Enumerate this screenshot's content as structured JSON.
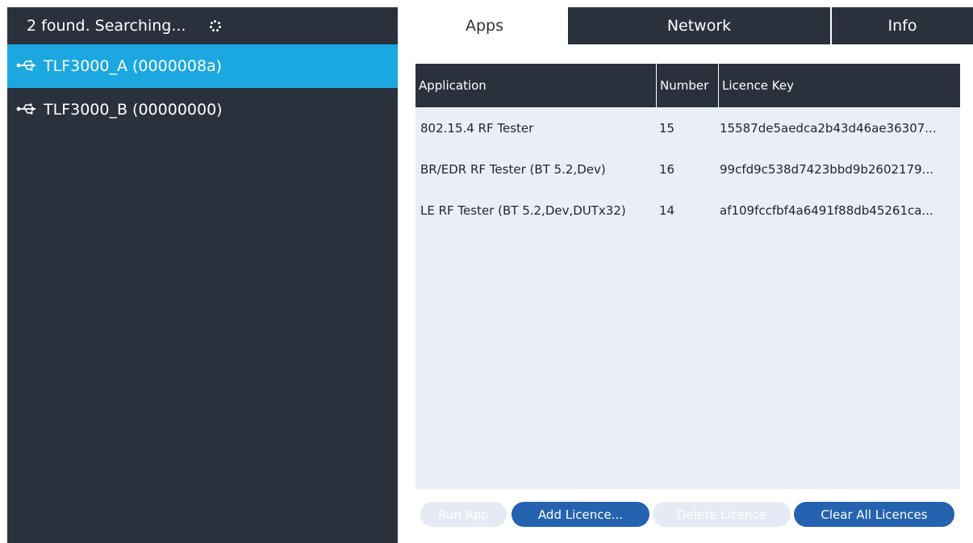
{
  "device_panel": {
    "status": "2 found. Searching...",
    "devices": [
      {
        "label": "TLF3000_A (0000008a)",
        "selected": true
      },
      {
        "label": "TLF3000_B (00000000)",
        "selected": false
      }
    ]
  },
  "tabs": [
    {
      "label": "Apps",
      "active": true
    },
    {
      "label": "Network",
      "active": false
    },
    {
      "label": "Info",
      "active": false
    }
  ],
  "apps_table": {
    "columns": [
      "Application",
      "Number",
      "Licence Key"
    ],
    "rows": [
      {
        "application": "802.15.4 RF Tester",
        "number": "15",
        "key": "15587de5aedca2b43d46ae36307..."
      },
      {
        "application": "BR/EDR RF Tester (BT 5.2,Dev)",
        "number": "16",
        "key": "99cfd9c538d7423bbd9b2602179..."
      },
      {
        "application": "LE RF Tester (BT 5.2,Dev,DUTx32)",
        "number": "14",
        "key": "af109fccfbf4a6491f88db45261ca..."
      }
    ]
  },
  "buttons": {
    "run_app": "Run App",
    "add_licence": "Add Licence...",
    "delete_licence": "Delete Licence",
    "clear_all": "Clear All Licences"
  },
  "colors": {
    "panel_dark": "#2b313c",
    "selection_blue": "#1ba8e0",
    "button_blue": "#2563b0",
    "table_bg": "#eaeef6"
  },
  "icons": {
    "device": "usb-icon",
    "status": "spinner-icon"
  }
}
